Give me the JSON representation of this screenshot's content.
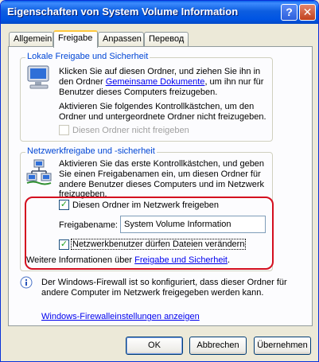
{
  "window": {
    "title": "Eigenschaften von System Volume Information"
  },
  "titlebar_buttons": {
    "help": "?",
    "close": "✕"
  },
  "tabs": [
    {
      "label": "Allgemein",
      "active": false
    },
    {
      "label": "Freigabe",
      "active": true
    },
    {
      "label": "Anpassen",
      "active": false
    },
    {
      "label": "Перевод",
      "active": false
    }
  ],
  "local": {
    "title": "Lokale Freigabe und Sicherheit",
    "para1_line1": "Klicken Sie auf diesen Ordner, und ziehen Sie ihn in",
    "para1_prefix": "den Ordner ",
    "para1_link": "Gemeinsame Dokumente",
    "para1_suffix": ", um ihn nur für",
    "para1_line3": "Benutzer dieses Computers freizugeben.",
    "para2_line1": "Aktivieren Sie folgendes Kontrollkästchen, um den",
    "para2_line2": "Ordner und untergeordnete Ordner nicht freizugeben.",
    "checkbox_label": "Diesen Ordner nicht freigeben",
    "checkbox_checked": false,
    "checkbox_enabled": false
  },
  "network": {
    "title": "Netzwerkfreigabe und -sicherheit",
    "desc_line1": "Aktivieren Sie das erste Kontrollkästchen, und geben",
    "desc_line2": "Sie einen Freigabenamen ein, um diesen Ordner für",
    "desc_line3": "andere Benutzer dieses Computers und im Netzwerk",
    "desc_line4": "freizugeben.",
    "share_checkbox_label": "Diesen Ordner im Netzwerk freigeben",
    "share_checked": true,
    "share_name_label": "Freigabename:",
    "share_name_value": "System Volume Information",
    "allow_change_label": "Netzwerkbenutzer dürfen Dateien verändern",
    "allow_change_checked": true,
    "more_info_prefix": "Weitere Informationen über ",
    "more_info_link": "Freigabe und Sicherheit",
    "more_info_suffix": "."
  },
  "firewall": {
    "line1": "Der Windows-Firewall ist so konfiguriert, dass dieser Ordner für",
    "line2": "andere Computer im Netzwerk freigegeben werden kann.",
    "link": "Windows-Firewalleinstellungen anzeigen"
  },
  "buttons": {
    "ok": "OK",
    "cancel": "Abbrechen",
    "apply": "Übernehmen"
  },
  "check_mark": "✓",
  "icons": [
    "computer-monitor-icon",
    "network-share-icon",
    "info-icon"
  ]
}
